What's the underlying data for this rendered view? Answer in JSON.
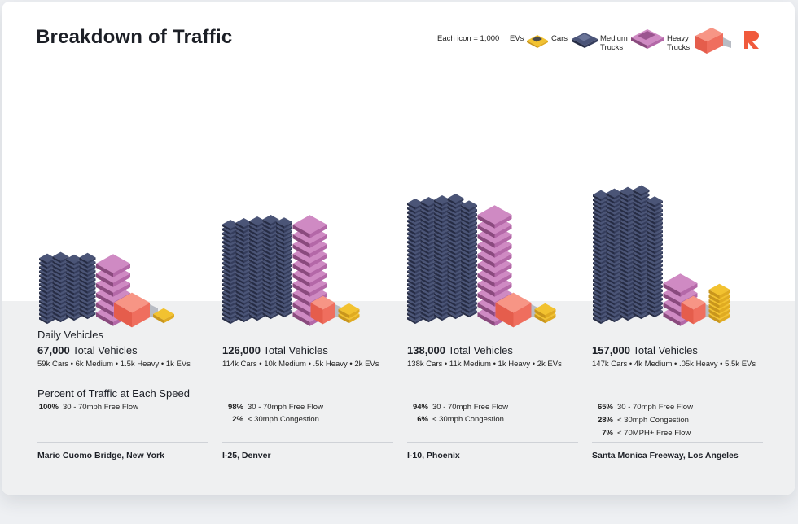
{
  "title": "Breakdown of Traffic",
  "legend": {
    "note": "Each icon = 1,000",
    "items": [
      {
        "label": "EVs",
        "icon": "ev-icon",
        "color": "#f2c230"
      },
      {
        "label": "Cars",
        "icon": "car-icon",
        "color": "#353d5c"
      },
      {
        "label": "Medium Trucks",
        "icon": "medium-truck-icon",
        "color": "#b468a8"
      },
      {
        "label": "Heavy Trucks",
        "icon": "heavy-truck-icon",
        "color": "#ef6e5e"
      }
    ]
  },
  "brand_color": "#f05a3c",
  "sections": {
    "daily": "Daily Vehicles",
    "speed": "Percent of Traffic at Each Speed"
  },
  "chart_data": {
    "type": "bar",
    "unit": "vehicles per day (each icon = 1,000)",
    "categories": [
      "Mario Cuomo Bridge, New York",
      "I-25, Denver",
      "I-10, Phoenix",
      "Santa Monica Freeway, Los Angeles"
    ],
    "series": [
      {
        "name": "Cars",
        "values": [
          59000,
          114000,
          138000,
          147000
        ]
      },
      {
        "name": "Medium Trucks",
        "values": [
          6000,
          10000,
          11000,
          4000
        ]
      },
      {
        "name": "Heavy Trucks",
        "values": [
          1500,
          500,
          1000,
          50
        ]
      },
      {
        "name": "EVs",
        "values": [
          1000,
          2000,
          2000,
          5500
        ]
      }
    ]
  },
  "columns": [
    {
      "total_num": "67,000",
      "total_label": "Total Vehicles",
      "breakdown": "59k Cars • 6k Medium • 1.5k Heavy • 1k EVs",
      "speeds": [
        {
          "pct": "100%",
          "label": "30 - 70mph Free Flow"
        }
      ],
      "location": "Mario Cuomo Bridge, New York"
    },
    {
      "total_num": "126,000",
      "total_label": "Total Vehicles",
      "breakdown": "114k Cars • 10k Medium • .5k Heavy • 2k EVs",
      "speeds": [
        {
          "pct": "98%",
          "label": "30 - 70mph Free Flow"
        },
        {
          "pct": "2%",
          "label": "< 30mph Congestion"
        }
      ],
      "location": "I-25, Denver"
    },
    {
      "total_num": "138,000",
      "total_label": "Total Vehicles",
      "breakdown": "138k Cars • 11k Medium • 1k Heavy • 2k EVs",
      "speeds": [
        {
          "pct": "94%",
          "label": "30 - 70mph Free Flow"
        },
        {
          "pct": "6%",
          "label": "< 30mph Congestion"
        }
      ],
      "location": "I-10, Phoenix"
    },
    {
      "total_num": "157,000",
      "total_label": "Total Vehicles",
      "breakdown": "147k Cars • 4k Medium • .05k Heavy • 5.5k EVs",
      "speeds": [
        {
          "pct": "65%",
          "label": "30 - 70mph Free Flow"
        },
        {
          "pct": "28%",
          "label": "< 30mph Congestion"
        },
        {
          "pct": "7%",
          "label": "< 70MPH+ Free Flow"
        }
      ],
      "location": "Santa Monica Freeway, Los Angeles"
    }
  ]
}
